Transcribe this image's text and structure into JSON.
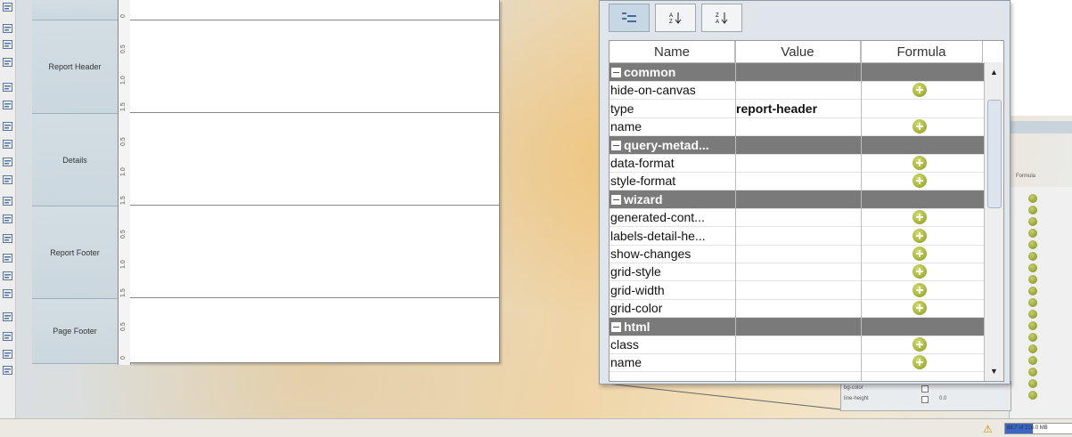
{
  "report_bands": [
    {
      "label": "Report Header"
    },
    {
      "label": "Details"
    },
    {
      "label": "Report Footer"
    },
    {
      "label": "Page Footer"
    }
  ],
  "ruler_ticks": [
    "0",
    "0.5",
    "1.0",
    "1.5"
  ],
  "properties": {
    "columns": {
      "name": "Name",
      "value": "Value",
      "formula": "Formula"
    },
    "rows": [
      {
        "group": true,
        "name": "common"
      },
      {
        "name": "hide-on-canvas",
        "value": "",
        "formula": true
      },
      {
        "name": "type",
        "value": "report-header",
        "formula": false
      },
      {
        "name": "name",
        "value": "",
        "formula": true
      },
      {
        "group": true,
        "name": "query-metad..."
      },
      {
        "name": "data-format",
        "value": "",
        "formula": true
      },
      {
        "name": "style-format",
        "value": "",
        "formula": true
      },
      {
        "group": true,
        "name": "wizard"
      },
      {
        "name": "generated-cont...",
        "value": "",
        "formula": true
      },
      {
        "name": "labels-detail-he...",
        "value": "",
        "formula": true
      },
      {
        "name": "show-changes",
        "value": "",
        "formula": true
      },
      {
        "name": "grid-style",
        "value": "",
        "formula": true
      },
      {
        "name": "grid-width",
        "value": "",
        "formula": true
      },
      {
        "name": "grid-color",
        "value": "",
        "formula": true
      },
      {
        "group": true,
        "name": "html"
      },
      {
        "name": "class",
        "value": "",
        "formula": true
      },
      {
        "name": "name",
        "value": "",
        "formula": true
      }
    ]
  },
  "right_panel": {
    "formula_header": "Formula"
  },
  "mini_panel": {
    "row1": "bg-color",
    "row2": "line-height",
    "row2_value": "0.0"
  },
  "status": {
    "memory": "88.7 of 216.0 MB",
    "memory_fraction": 0.41
  }
}
